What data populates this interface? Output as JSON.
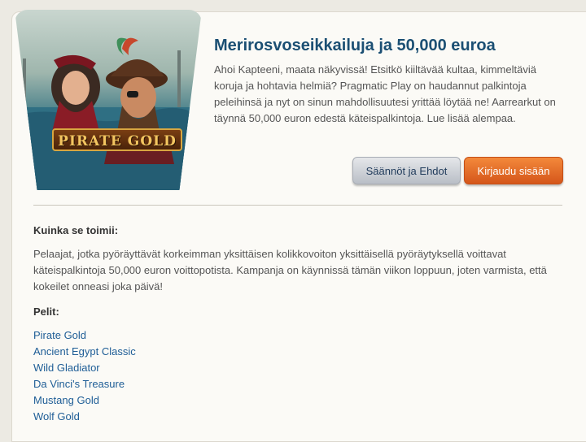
{
  "promo": {
    "logo_text": "PIRATE GOLD",
    "title": "Merirosvoseikkailuja ja 50,000 euroa",
    "intro": "Ahoi Kapteeni, maata näkyvissä! Etsitkö kiiltävää kultaa, kimmeltäviä koruja ja hohtavia helmiä? Pragmatic Play on haudannut palkintoja peleihinsä ja nyt on sinun mahdollisuutesi yrittää löytää ne! Aarrearkut on täynnä 50,000 euron edestä käteispalkintoja. Lue lisää alempaa.",
    "rules_button": "Säännöt ja Ehdot",
    "login_button": "Kirjaudu sisään"
  },
  "how": {
    "heading": "Kuinka se toimii:",
    "text": "Pelaajat, jotka pyöräyttävät korkeimman yksittäisen kolikkovoiton yksittäisellä pyöräytyksellä voittavat käteispalkintoja 50,000 euron voittopotista. Kampanja on käynnissä tämän viikon loppuun, joten varmista, että kokeilet onneasi joka päivä!"
  },
  "games": {
    "heading": "Pelit:",
    "items": [
      "Pirate Gold",
      "Ancient Egypt Classic",
      "Wild Gladiator",
      "Da Vinci's Treasure",
      "Mustang Gold",
      "Wolf Gold"
    ]
  },
  "colors": {
    "title": "#1b4f73",
    "link": "#1e5d96",
    "login_button": "#e8702b",
    "rules_button": "#c9cdd3"
  }
}
